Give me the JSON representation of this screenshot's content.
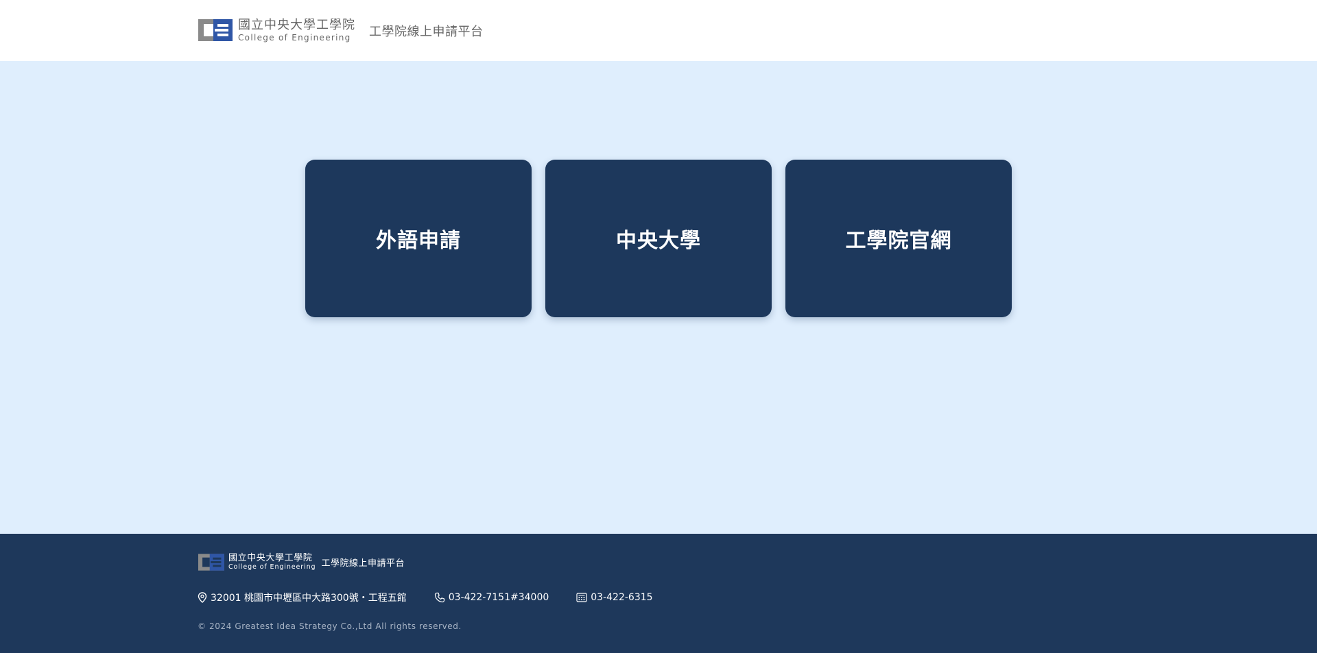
{
  "header": {
    "logo_zh": "國立中央大學工學院",
    "logo_en": "College of Engineering",
    "site_title": "工學院線上申請平台"
  },
  "cards": [
    {
      "label": "外語申請",
      "icon": "none"
    },
    {
      "label": "中央大學",
      "icon": "none"
    },
    {
      "label": "工學院官網",
      "icon": "none"
    }
  ],
  "footer": {
    "logo_zh": "國立中央大學工學院",
    "logo_en": "College of Engineering",
    "site_title": "工學院線上申請平台",
    "address": "32001 桃園市中壢區中大路300號・工程五館",
    "phone": "03-422-7151#34000",
    "fax": "03-422-6315",
    "copyright": "© 2024 Greatest Idea Strategy Co.,Ltd All rights reserved."
  },
  "colors": {
    "header_bg": "#ffffff",
    "page_bg": "#dfeefd",
    "card_bg": "#1d385c",
    "footer_bg": "#1e385b",
    "logo_blue": "#2f56a6",
    "logo_gray": "#8a8a8a"
  },
  "icons": {
    "address": "map-pin-icon",
    "phone": "phone-icon",
    "fax": "fax-icon"
  }
}
